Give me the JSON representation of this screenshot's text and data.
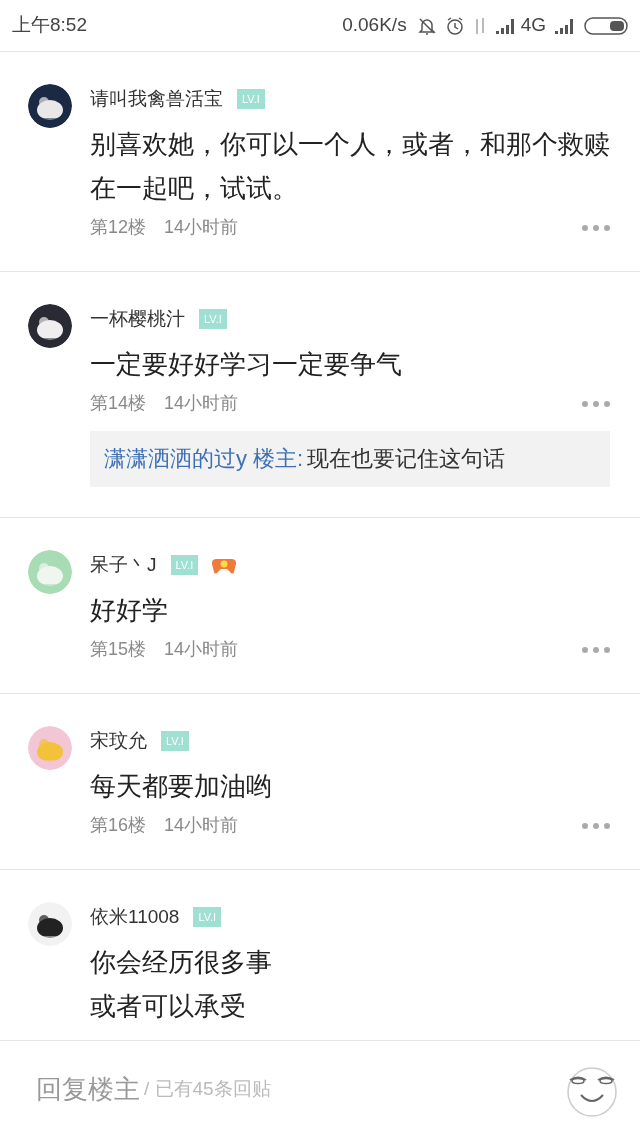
{
  "status_bar": {
    "time": "上午8:52",
    "speed": "0.06K/s",
    "network": "4G"
  },
  "posts": [
    {
      "user": "请叫我禽兽活宝",
      "level": "LV.I",
      "content": [
        "别喜欢她，你可以一个人，或者，和那个救赎在一起吧，试试。"
      ],
      "floor": "第12楼",
      "time": "14小时前"
    },
    {
      "user": "一杯樱桃汁",
      "level": "LV.I",
      "content": [
        "一定要好好学习一定要争气"
      ],
      "floor": "第14楼",
      "time": "14小时前",
      "replies": [
        {
          "author": "潇潇洒洒的过y 楼主:",
          "text": "现在也要记住这句话"
        }
      ]
    },
    {
      "user": "呆子丶J",
      "level": "LV.I",
      "badges": [
        {
          "kind": "game"
        }
      ],
      "content": [
        "好好学"
      ],
      "floor": "第15楼",
      "time": "14小时前"
    },
    {
      "user": "宋玟允",
      "level": "LV.I",
      "content": [
        "每天都要加油哟"
      ],
      "floor": "第16楼",
      "time": "14小时前"
    },
    {
      "user": "依米11008",
      "level": "LV.I",
      "content": [
        "你会经历很多事",
        "或者可以承受"
      ]
    }
  ],
  "reply_bar": {
    "placeholder": "回复楼主",
    "count": "/ 已有45条回贴"
  }
}
